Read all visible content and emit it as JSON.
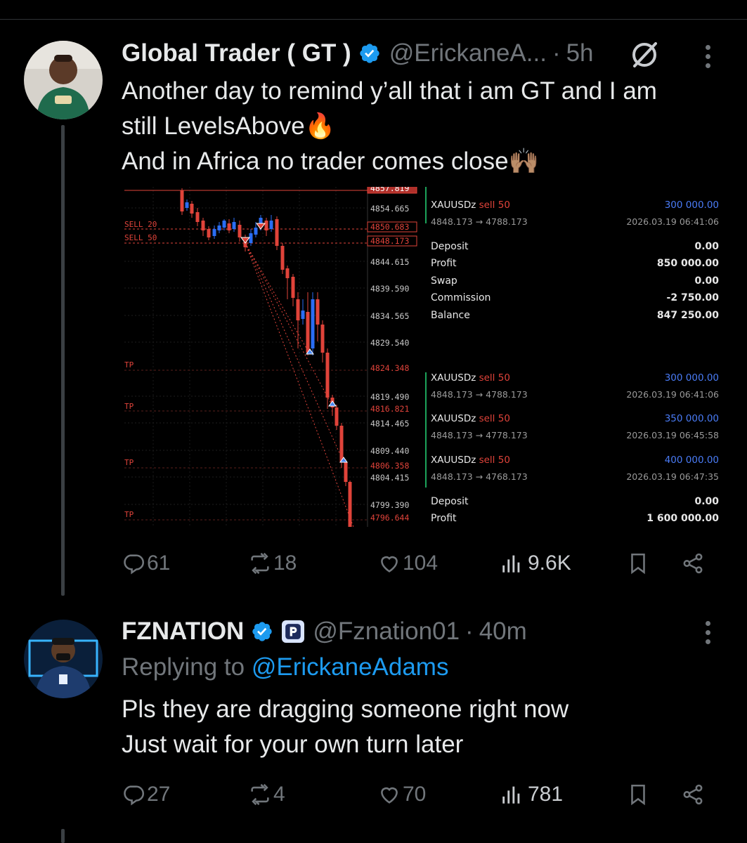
{
  "tweet1": {
    "name": "Global Trader ( GT )",
    "handle": "@ErickaneA...",
    "separator": "·",
    "time": "5h",
    "text": "Another day to remind y’all that i am GT and I am\nstill LevelsAbove🔥\nAnd in Africa no trader comes close🙌🏽",
    "actions": {
      "replies": "61",
      "reposts": "18",
      "likes": "104",
      "views": "9.6K"
    }
  },
  "chart": {
    "price_labels": [
      "4854.665",
      "4844.615",
      "4839.590",
      "4834.565",
      "4829.540",
      "4819.490",
      "4814.465",
      "4809.440",
      "4804.415",
      "4799.390"
    ],
    "red_labels": [
      "4857.819",
      "4850.683",
      "4848.173",
      "4824.348",
      "4816.821",
      "4806.358",
      "4796.644"
    ],
    "sell_labels": [
      "SELL 20",
      "SELL 50"
    ],
    "tp_label": "TP",
    "trade1": {
      "symbol": "XAUUSDz",
      "side": "sell 50",
      "route": "4848.173 → 4788.173",
      "profit": "300 000.00",
      "time": "2026.03.19 06:41:06"
    },
    "summary1": [
      {
        "label": "Deposit",
        "value": "0.00"
      },
      {
        "label": "Profit",
        "value": "850 000.00"
      },
      {
        "label": "Swap",
        "value": "0.00"
      },
      {
        "label": "Commission",
        "value": "-2 750.00"
      },
      {
        "label": "Balance",
        "value": "847 250.00"
      }
    ],
    "trades": [
      {
        "symbol": "XAUUSDz",
        "side": "sell 50",
        "route": "4848.173 → 4788.173",
        "profit": "300 000.00",
        "time": "2026.03.19 06:41:06"
      },
      {
        "symbol": "XAUUSDz",
        "side": "sell 50",
        "route": "4848.173 → 4778.173",
        "profit": "350 000.00",
        "time": "2026.03.19 06:45:58"
      },
      {
        "symbol": "XAUUSDz",
        "side": "sell 50",
        "route": "4848.173 → 4768.173",
        "profit": "400 000.00",
        "time": "2026.03.19 06:47:35"
      }
    ],
    "summary2": [
      {
        "label": "Deposit",
        "value": "0.00"
      },
      {
        "label": "Profit",
        "value": "1 600 000.00"
      }
    ]
  },
  "tweet2": {
    "name": "FZNATION",
    "handle": "@Fznation01",
    "separator": "·",
    "time": "40m",
    "replying_prefix": "Replying to ",
    "replying_to": "@ErickaneAdams",
    "text": "Pls they are dragging someone right now\nJust wait for your own turn later",
    "actions": {
      "replies": "27",
      "reposts": "4",
      "likes": "70",
      "views": "781"
    }
  },
  "colors": {
    "accent": "#1d9bf0",
    "muted": "#71767b",
    "sell_red": "#e0433a",
    "profit_blue": "#4a7cf7",
    "bull_blue": "#2a6df4"
  }
}
